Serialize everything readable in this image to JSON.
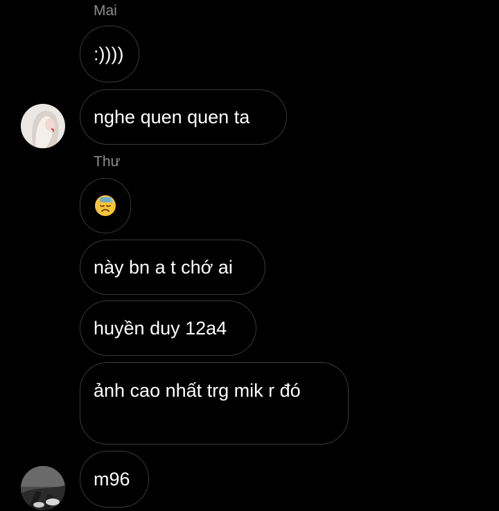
{
  "chat": {
    "senders": {
      "mai": "Mai",
      "thu": "Thư"
    },
    "messages": [
      {
        "text": ":))))"
      },
      {
        "text": "nghe quen quen ta"
      },
      {
        "emoji": "downcast-sweat-face"
      },
      {
        "text": "này bn a t chớ ai"
      },
      {
        "text": "huyền duy 12a4"
      },
      {
        "text": "ảnh cao nhất trg mik r đó"
      },
      {
        "text": "m96"
      }
    ]
  },
  "colors": {
    "background": "#000000",
    "bubble_border": "#3a3a3a",
    "sender_name": "#8e8e8e",
    "text": "#ffffff"
  }
}
